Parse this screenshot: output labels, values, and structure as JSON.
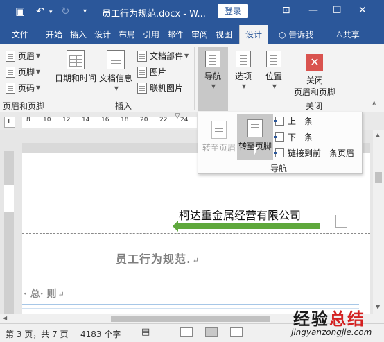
{
  "window": {
    "title": "员工行为规范.docx - W...",
    "login_label": "登录"
  },
  "tabs": [
    "文件",
    "开始",
    "插入",
    "设计",
    "布局",
    "引用",
    "邮件",
    "审阅",
    "视图",
    "设计"
  ],
  "tell_me": "告诉我",
  "share": "共享",
  "ribbon": {
    "hf_group": {
      "items": [
        "页眉",
        "页脚",
        "页码"
      ],
      "label": "页眉和页脚"
    },
    "insert_group": {
      "datetime": "日期和时间",
      "docinfo": "文档信息",
      "docparts": "文档部件",
      "picture": "图片",
      "online_picture": "联机图片",
      "label": "插入"
    },
    "nav_button": "导航",
    "options_button": "选项",
    "position_button": "位置",
    "close_group": {
      "close_line1": "关闭",
      "close_line2": "页眉和页脚",
      "label": "关闭"
    }
  },
  "nav_dropdown": {
    "goto_header": "转至页眉",
    "goto_footer": "转至页脚",
    "previous": "上一条",
    "next": "下一条",
    "link_previous": "链接到前一条页眉",
    "group_label": "导航"
  },
  "ruler": {
    "tab_selector": "L",
    "ticks": [
      "8",
      "10",
      "12",
      "14",
      "16",
      "18",
      "20",
      "22",
      "24"
    ]
  },
  "document": {
    "header_text": "柯达重金属经营有限公司",
    "title": "员工行为规范.",
    "section": "· 总· 则"
  },
  "statusbar": {
    "page": "第 3 页，共 7 页",
    "words": "4183 个字"
  },
  "watermark": {
    "text_a": "经验",
    "text_b": "总结",
    "url": "jingyanzongjie.com"
  },
  "colors": {
    "accent": "#2b579a",
    "header_highlight": "#5fa83c",
    "close_button": "#d9534f"
  }
}
